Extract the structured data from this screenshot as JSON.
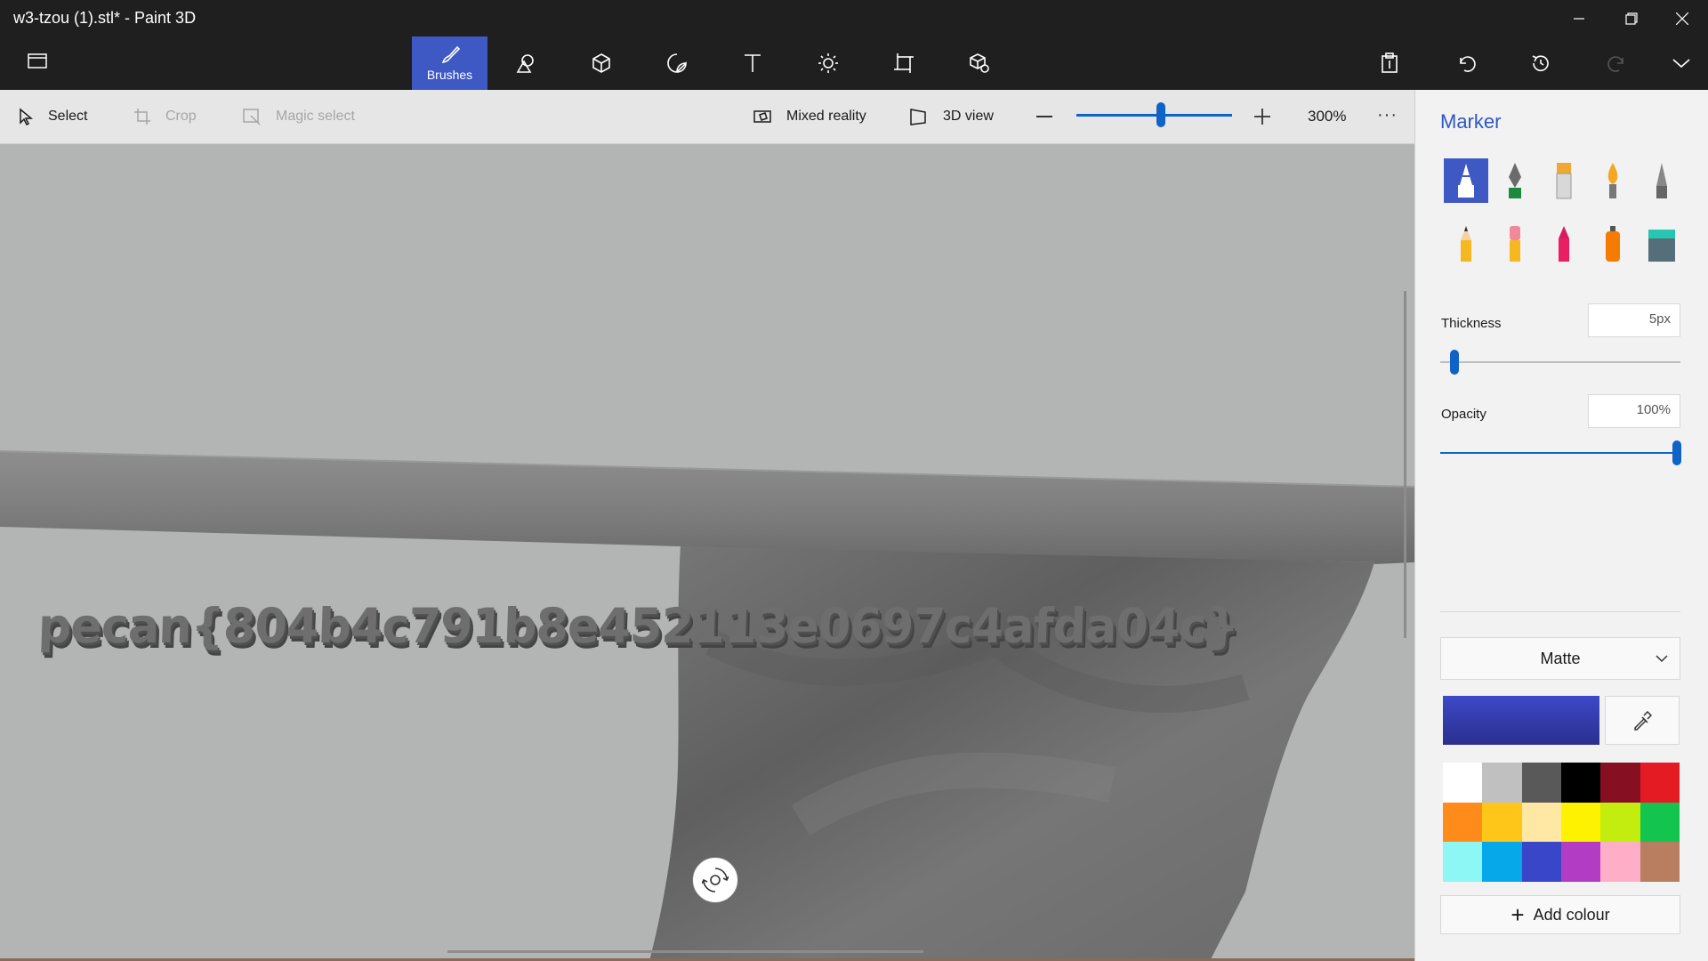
{
  "window": {
    "title": "w3-tzou (1).stl* - Paint 3D"
  },
  "toolbar": {
    "tools": [
      {
        "name": "brushes",
        "label": "Brushes",
        "icon": "brush-icon",
        "active": true
      },
      {
        "name": "2d-shapes",
        "label": "",
        "icon": "2d-shapes-icon",
        "active": false
      },
      {
        "name": "3d-shapes",
        "label": "",
        "icon": "3d-shapes-icon",
        "active": false
      },
      {
        "name": "stickers",
        "label": "",
        "icon": "stickers-icon",
        "active": false
      },
      {
        "name": "text",
        "label": "",
        "icon": "text-icon",
        "active": false
      },
      {
        "name": "effects",
        "label": "",
        "icon": "effects-icon",
        "active": false
      },
      {
        "name": "canvas",
        "label": "",
        "icon": "canvas-icon",
        "active": false
      },
      {
        "name": "3d-library",
        "label": "",
        "icon": "3d-library-icon",
        "active": false
      }
    ],
    "accent": "#3e58c4"
  },
  "subtoolbar": {
    "select_label": "Select",
    "crop_label": "Crop",
    "magic_select_label": "Magic select",
    "mixed_reality_label": "Mixed reality",
    "view3d_label": "3D view",
    "zoom_value": "300%",
    "zoom_level_fraction": 0.6,
    "more_label": "···"
  },
  "canvas": {
    "model_text": "pecan{804b4c791b8e452113e0697c4afda04c}",
    "background": "#b3b5b4"
  },
  "panel": {
    "title": "Marker",
    "brushes": [
      "marker-icon",
      "calligraphy-pen-icon",
      "oil-brush-icon",
      "watercolor-icon",
      "pixel-pen-icon",
      "pencil-icon",
      "eraser-icon",
      "crayon-icon",
      "spray-can-icon",
      "fill-icon"
    ],
    "thickness_label": "Thickness",
    "thickness_value": "5px",
    "thickness_fraction": 0.06,
    "opacity_label": "Opacity",
    "opacity_value": "100%",
    "opacity_fraction": 1.0,
    "finish_value": "Matte",
    "current_color": "#3d49c9",
    "palette": [
      "#ffffff",
      "#c0c0c0",
      "#595959",
      "#000000",
      "#870f22",
      "#e51b24",
      "#ff8b1a",
      "#ffc61a",
      "#ffe8a3",
      "#fff200",
      "#c3ed0e",
      "#13c44f",
      "#8cf7f5",
      "#06a8ea",
      "#3a46c9",
      "#b33cc4",
      "#ffaec8",
      "#b97e5f"
    ],
    "add_colour_label": "Add colour"
  }
}
